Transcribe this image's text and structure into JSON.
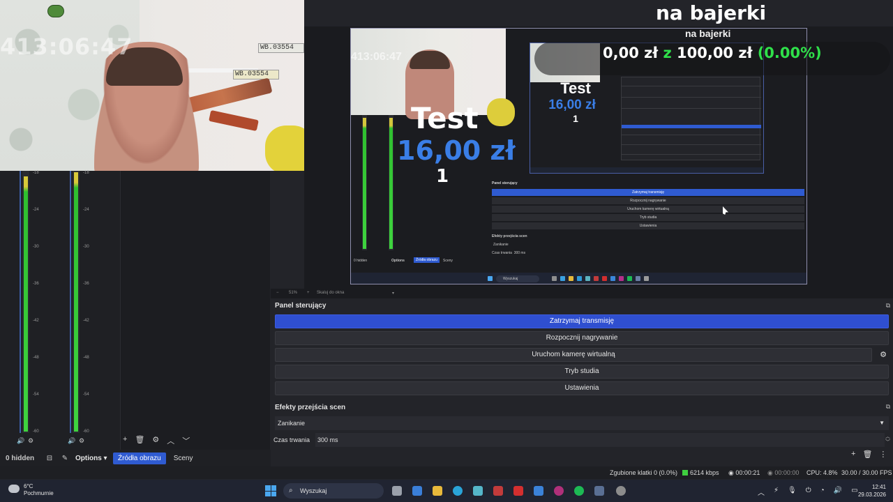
{
  "window": {
    "minimize": "—",
    "maximize": "❐",
    "close": "✕"
  },
  "webcam": {
    "clock": "413:06:47",
    "plate1": "WB.03554",
    "plate2": "WB.03554"
  },
  "overlay": {
    "title": "na bajerki",
    "goal_label": "na bajerki",
    "current": "0,00 zł",
    "sep": "z",
    "target": "100,00 zł",
    "percent": "(0.00%)"
  },
  "alert": {
    "text": "Test",
    "amount": "16,00 zł",
    "count": "1"
  },
  "meter_ticks": [
    "-18",
    "-24",
    "-30",
    "-36",
    "-42",
    "-48",
    "-54",
    "-60"
  ],
  "preview_bar": {
    "zoom": "51%",
    "fit": "Skaluj do okna"
  },
  "nested_preview": {
    "panel_title": "Panel sterujący",
    "buttons": [
      "Zatrzymaj transmisję",
      "Rozpocznij nagrywanie",
      "Uruchom kamerę wirtualną",
      "Tryb studia",
      "Ustawienia"
    ],
    "effects_title": "Efekty przejścia scen",
    "transition": "Zanikanie",
    "duration_label": "Czas trwania",
    "duration_value": "300 ms",
    "hidden": "0 hidden",
    "options": "Options",
    "tab_sources": "Źródła obrazu",
    "tab_scenes": "Sceny",
    "taskbar_search": "Wyszukaj"
  },
  "sources_dock": {
    "hidden": "0 hidden",
    "options": "Options",
    "tab_sources": "Źródła obrazu",
    "tab_scenes": "Sceny"
  },
  "controls": {
    "title": "Panel sterujący",
    "buttons": {
      "stop_stream": "Zatrzymaj transmisję",
      "start_rec": "Rozpocznij nagrywanie",
      "virtual_cam": "Uruchom kamerę wirtualną",
      "studio": "Tryb studia",
      "settings": "Ustawienia"
    }
  },
  "transitions": {
    "title": "Efekty przejścia scen",
    "selected": "Zanikanie",
    "duration_label": "Czas trwania",
    "duration_value": "300 ms"
  },
  "status": {
    "dropped": "Zgubione klatki 0 (0.0%)",
    "bitrate": "6214 kbps",
    "stream_time": "00:00:21",
    "rec_time": "00:00:00",
    "cpu": "CPU: 4.8%",
    "fps": "30.00 / 30.00 FPS"
  },
  "taskbar": {
    "temp": "6°C",
    "weather": "Pochmurnie",
    "search": "Wyszukaj",
    "time": "12:41",
    "date": "29.03.2026"
  },
  "colors": {
    "accent": "#2f4fd0",
    "meter_green": "#3fd43f",
    "goal_green": "#2fe04a",
    "money_blue": "#3a7ee6"
  }
}
